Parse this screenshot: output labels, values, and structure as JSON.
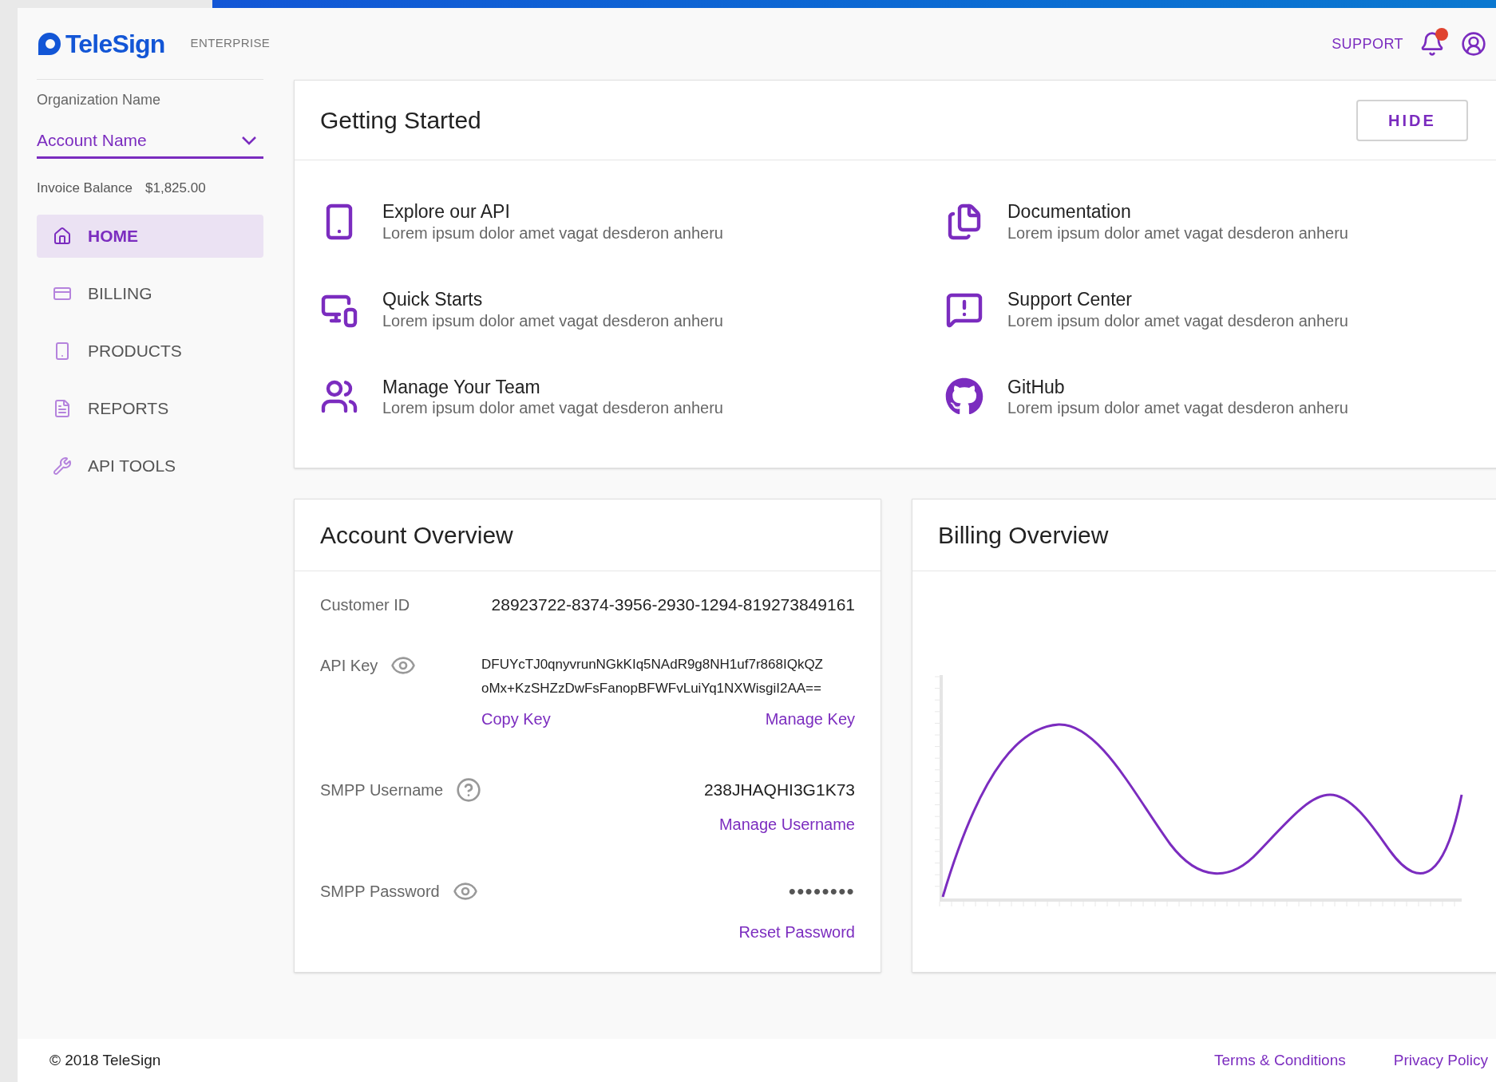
{
  "header": {
    "brand": "TeleSign",
    "edition": "ENTERPRISE",
    "support_link": "SUPPORT",
    "notifications": {
      "unread": true
    }
  },
  "sidebar": {
    "organization_label": "Organization Name",
    "account_select": "Account Name",
    "invoice_label": "Invoice Balance",
    "invoice_amount": "$1,825.00",
    "items": [
      {
        "label": "HOME",
        "selected": true
      },
      {
        "label": "BILLING",
        "selected": false
      },
      {
        "label": "PRODUCTS",
        "selected": false
      },
      {
        "label": "REPORTS",
        "selected": false
      },
      {
        "label": "API TOOLS",
        "selected": false
      }
    ]
  },
  "getting_started": {
    "title": "Getting Started",
    "hide_button": "HIDE",
    "items": [
      {
        "title": "Explore our API",
        "description": "Lorem ipsum dolor amet vagat desderon anheru"
      },
      {
        "title": "Documentation",
        "description": "Lorem ipsum dolor amet vagat desderon anheru"
      },
      {
        "title": "Quick Starts",
        "description": "Lorem ipsum dolor amet vagat desderon anheru"
      },
      {
        "title": "Support Center",
        "description": "Lorem ipsum dolor amet vagat desderon anheru"
      },
      {
        "title": "Manage Your Team",
        "description": "Lorem ipsum dolor amet vagat desderon anheru"
      },
      {
        "title": "GitHub",
        "description": "Lorem ipsum dolor amet vagat desderon anheru"
      }
    ]
  },
  "account_overview": {
    "title": "Account Overview",
    "customer_id_label": "Customer ID",
    "customer_id": "28923722-8374-3956-2930-1294-819273849161",
    "api_key_label": "API Key",
    "api_key_lines": [
      "DFUYcTJ0qnyvrunNGkKIq5NAdR9g8NH1uf7r868IQkQZ",
      "oMx+KzSHZzDwFsFanopBFWFvLuiYq1NXWisgiI2AA=="
    ],
    "copy_key": "Copy Key",
    "manage_key": "Manage Key",
    "smpp_username_label": "SMPP Username",
    "smpp_username": "238JHAQHI3G1K73",
    "manage_username": "Manage Username",
    "smpp_password_label": "SMPP Password",
    "smpp_password": "••••••••",
    "reset_password": "Reset Password"
  },
  "billing_overview": {
    "title": "Billing Overview"
  },
  "footer": {
    "copyright": "© 2018 TeleSign",
    "links": [
      "Terms & Conditions",
      "Privacy Policy"
    ]
  }
}
